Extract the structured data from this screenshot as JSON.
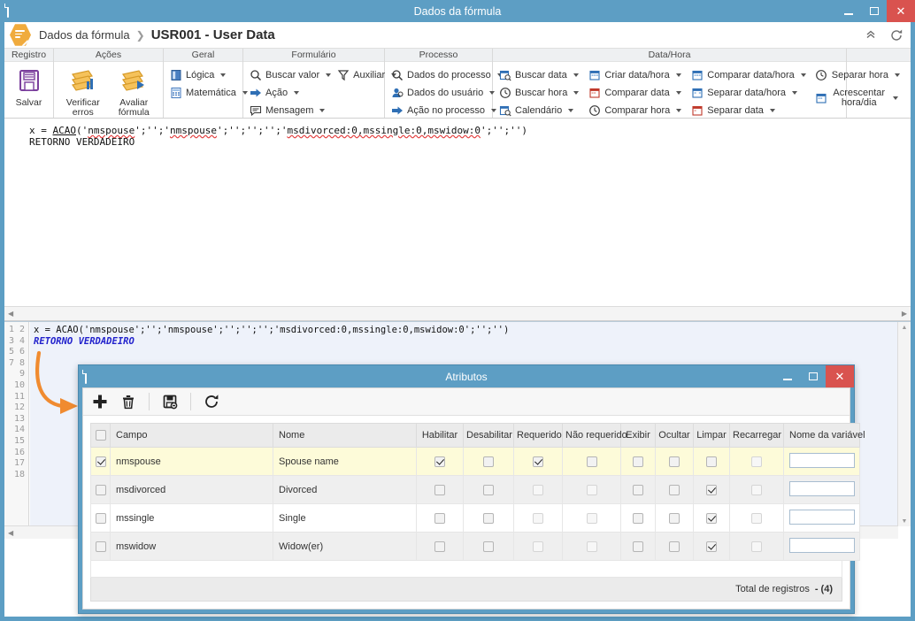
{
  "window": {
    "title": "Dados da fórmula",
    "minimize_label": "–",
    "maximize_label": "□",
    "close_label": "✕"
  },
  "breadcrumb": {
    "parent": "Dados da fórmula",
    "separator": "❯",
    "current": "USR001 - User Data",
    "collapse_label": "⌃",
    "refresh_label": "⟳"
  },
  "ribbon": {
    "groups": [
      {
        "label": "Registro",
        "buttons": [
          {
            "label": "Salvar",
            "icon": "save-icon"
          }
        ]
      },
      {
        "label": "Ações",
        "buttons": [
          {
            "label": "Verificar erros",
            "icon": "check-errors-icon"
          },
          {
            "label": "Avaliar fórmula",
            "icon": "evaluate-formula-icon"
          }
        ]
      },
      {
        "label": "Geral",
        "items": [
          {
            "label": "Lógica",
            "icon": "book-icon",
            "caret": true
          },
          {
            "label": "Matemática",
            "icon": "calculator-icon",
            "caret": true
          }
        ]
      },
      {
        "label": "Formulário",
        "items": [
          {
            "label": "Buscar valor",
            "icon": "magnifier-icon",
            "caret": true
          },
          {
            "label": "Auxiliar",
            "icon": "funnel-icon",
            "caret": true
          },
          {
            "label": "Ação",
            "icon": "arrow-right-icon",
            "caret": true
          },
          {
            "label": "Mensagem",
            "icon": "message-icon",
            "caret": true
          }
        ]
      },
      {
        "label": "Processo",
        "items": [
          {
            "label": "Dados do processo",
            "icon": "magnifier-icon",
            "caret": true
          },
          {
            "label": "Dados do usuário",
            "icon": "user-icon",
            "caret": true
          },
          {
            "label": "Ação no processo",
            "icon": "arrow-right-icon",
            "caret": true
          }
        ]
      },
      {
        "label": "Data/Hora",
        "items": [
          {
            "label": "Buscar data",
            "icon": "calendar-search-icon",
            "caret": true
          },
          {
            "label": "Criar data/hora",
            "icon": "calendar-icon",
            "caret": true
          },
          {
            "label": "Comparar data/hora",
            "icon": "calendar-icon",
            "caret": true
          },
          {
            "label": "Separar hora",
            "icon": "clock-icon",
            "caret": true
          },
          {
            "label": "Buscar hora",
            "icon": "clock-icon",
            "caret": true
          },
          {
            "label": "Comparar data",
            "icon": "calendar-icon",
            "caret": true
          },
          {
            "label": "Separar data/hora",
            "icon": "calendar-icon",
            "caret": true
          },
          {
            "label": "Acrescentar hora/dia",
            "icon": "calendar-icon",
            "caret": true
          },
          {
            "label": "Calendário",
            "icon": "calendar-search-icon",
            "caret": true
          },
          {
            "label": "Comparar hora",
            "icon": "clock-icon",
            "caret": true
          },
          {
            "label": "Separar data",
            "icon": "calendar-icon",
            "caret": true
          }
        ]
      }
    ]
  },
  "editor": {
    "code_line_1": "x = ACAO('nmspouse';'';'nmspouse';'';'';'';'msdivorced:0,mssingle:0,mswidow:0';'';'')",
    "code_line_2": "RETORNO VERDADEIRO",
    "line_numbers": "1\n2\n3\n4\n5\n6\n7\n8\n9\n10\n11\n12\n13\n14\n15\n16\n17\n18"
  },
  "dialog": {
    "title": "Atributos",
    "minimize_label": "–",
    "maximize_label": "□",
    "close_label": "✕",
    "toolbar": [
      {
        "name": "add-icon",
        "glyph": "✚"
      },
      {
        "name": "delete-icon",
        "glyph": "🗑"
      },
      {
        "name": "save-icon",
        "glyph": "💾"
      },
      {
        "name": "refresh-icon",
        "glyph": "⟳"
      }
    ],
    "table": {
      "columns": [
        "Campo",
        "Nome",
        "Habilitar",
        "Desabilitar",
        "Requerido",
        "Não requerido",
        "Exibir",
        "Ocultar",
        "Limpar",
        "Recarregar",
        "Nome da variável"
      ],
      "rows": [
        {
          "selected": true,
          "campo": "nmspouse",
          "nome": "Spouse name",
          "habilitar": true,
          "desabilitar": false,
          "requerido": true,
          "nao_requerido": false,
          "exibir": false,
          "ocultar": false,
          "limpar": false,
          "recarregar": false,
          "variavel": ""
        },
        {
          "selected": false,
          "campo": "msdivorced",
          "nome": "Divorced",
          "habilitar": false,
          "desabilitar": false,
          "requerido": false,
          "nao_requerido": false,
          "exibir": false,
          "ocultar": false,
          "limpar": true,
          "recarregar": false,
          "variavel": ""
        },
        {
          "selected": false,
          "campo": "mssingle",
          "nome": "Single",
          "habilitar": false,
          "desabilitar": false,
          "requerido": false,
          "nao_requerido": false,
          "exibir": false,
          "ocultar": false,
          "limpar": true,
          "recarregar": false,
          "variavel": ""
        },
        {
          "selected": false,
          "campo": "mswidow",
          "nome": "Widow(er)",
          "habilitar": false,
          "desabilitar": false,
          "requerido": false,
          "nao_requerido": false,
          "exibir": false,
          "ocultar": false,
          "limpar": true,
          "recarregar": false,
          "variavel": ""
        }
      ]
    },
    "footer": {
      "total_label": "Total de registros",
      "total_value": "- (4)"
    }
  },
  "colors": {
    "window_chrome": "#5d9ec4",
    "close_red": "#d9534f",
    "accent_orange": "#f0ab3d",
    "highlight_row": "#fdfbd9",
    "annotation_arrow": "#f08b30"
  }
}
